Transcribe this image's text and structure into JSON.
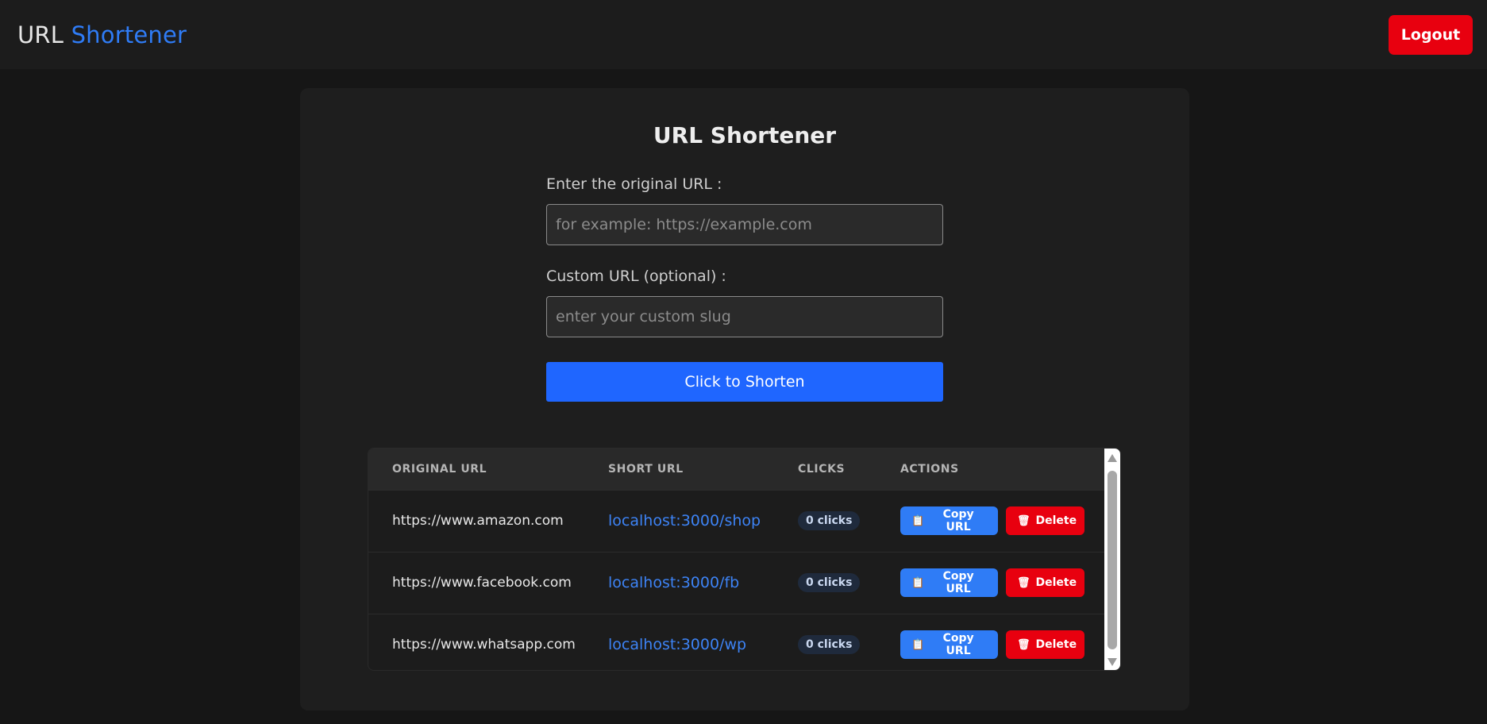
{
  "navbar": {
    "brand_part1": "URL",
    "brand_part2": "Shortener",
    "logout_label": "Logout"
  },
  "form": {
    "title": "URL Shortener",
    "original_label": "Enter the original URL :",
    "original_placeholder": "for example: https://example.com",
    "custom_label": "Custom URL (optional) :",
    "custom_placeholder": "enter your custom slug",
    "submit_label": "Click to Shorten"
  },
  "table": {
    "headers": [
      "ORIGINAL URL",
      "SHORT URL",
      "CLICKS",
      "ACTIONS"
    ],
    "copy_label": "Copy URL",
    "delete_label": "Delete",
    "rows": [
      {
        "original": "https://www.amazon.com",
        "short": "localhost:3000/shop",
        "clicks": "0 clicks"
      },
      {
        "original": "https://www.facebook.com",
        "short": "localhost:3000/fb",
        "clicks": "0 clicks"
      },
      {
        "original": "https://www.whatsapp.com",
        "short": "localhost:3000/wp",
        "clicks": "0 clicks"
      }
    ]
  },
  "colors": {
    "accent": "#2f7cf6",
    "danger": "#e8000f",
    "background": "#161616"
  },
  "icons": {
    "copy": "clipboard-icon",
    "delete": "trash-icon"
  }
}
